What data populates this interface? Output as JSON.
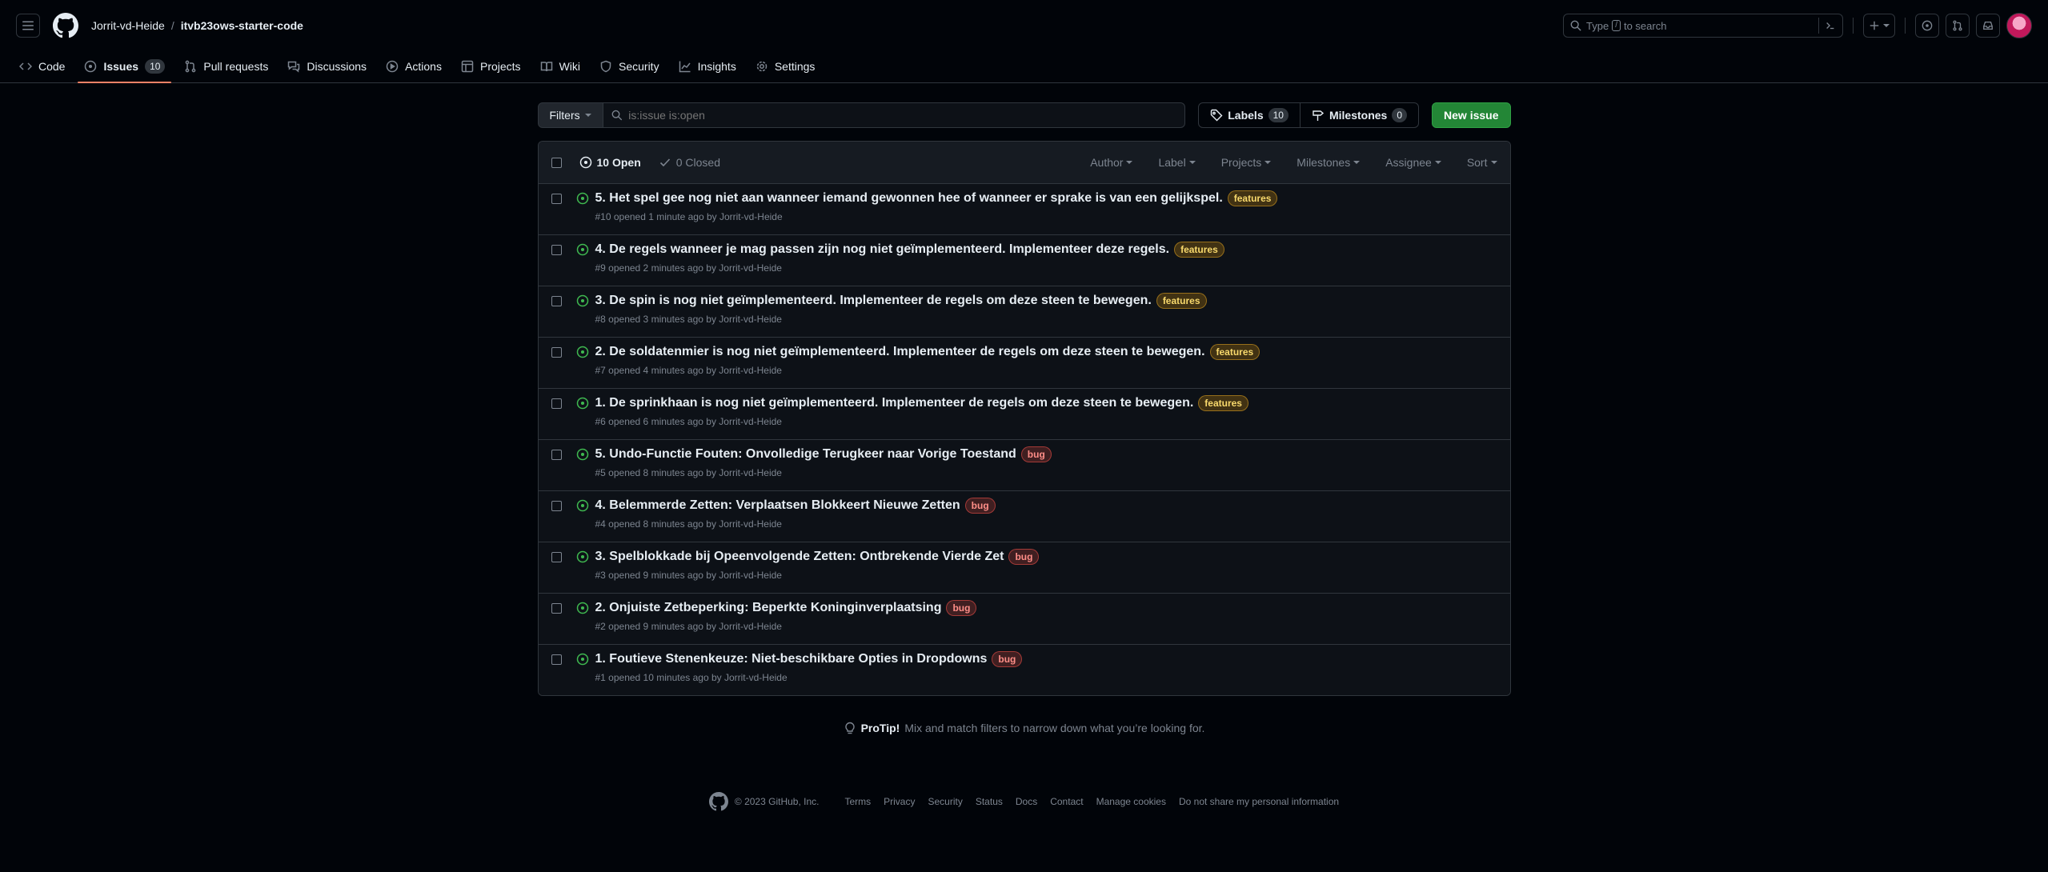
{
  "header": {
    "owner": "Jorrit-vd-Heide",
    "separator": "/",
    "repo": "itvb23ows-starter-code",
    "search_prefix": "Type",
    "search_key": "/",
    "search_suffix": "to search"
  },
  "nav": {
    "items": [
      {
        "label": "Code",
        "icon": "code-icon"
      },
      {
        "label": "Issues",
        "icon": "issue-opened-icon",
        "count": "10"
      },
      {
        "label": "Pull requests",
        "icon": "pull-request-icon"
      },
      {
        "label": "Discussions",
        "icon": "comment-discussion-icon"
      },
      {
        "label": "Actions",
        "icon": "play-icon"
      },
      {
        "label": "Projects",
        "icon": "table-icon"
      },
      {
        "label": "Wiki",
        "icon": "book-icon"
      },
      {
        "label": "Security",
        "icon": "shield-icon"
      },
      {
        "label": "Insights",
        "icon": "graph-icon"
      },
      {
        "label": "Settings",
        "icon": "gear-icon"
      }
    ]
  },
  "toolbar": {
    "filters_label": "Filters",
    "search_placeholder": "is:issue is:open",
    "labels_label": "Labels",
    "labels_count": "10",
    "milestones_label": "Milestones",
    "milestones_count": "0",
    "new_issue_label": "New issue"
  },
  "list_header": {
    "open_label": "10 Open",
    "closed_label": "0 Closed",
    "filters": [
      "Author",
      "Label",
      "Projects",
      "Milestones",
      "Assignee",
      "Sort"
    ]
  },
  "issues": [
    {
      "title": "5. Het spel gee nog niet aan wanneer iemand gewonnen hee of wanneer er sprake is van een gelijkspel.",
      "label": "features",
      "meta": "#10 opened 1 minute ago by Jorrit-vd-Heide"
    },
    {
      "title": "4. De regels wanneer je mag passen zijn nog niet geïmplementeerd. Implementeer deze regels.",
      "label": "features",
      "meta": "#9 opened 2 minutes ago by Jorrit-vd-Heide"
    },
    {
      "title": "3. De spin is nog niet geïmplementeerd. Implementeer de regels om deze steen te bewegen.",
      "label": "features",
      "meta": "#8 opened 3 minutes ago by Jorrit-vd-Heide"
    },
    {
      "title": "2. De soldatenmier is nog niet geïmplementeerd. Implementeer de regels om deze steen te bewegen.",
      "label": "features",
      "meta": "#7 opened 4 minutes ago by Jorrit-vd-Heide"
    },
    {
      "title": "1. De sprinkhaan is nog niet geïmplementeerd. Implementeer de regels om deze steen te bewegen.",
      "label": "features",
      "meta": "#6 opened 6 minutes ago by Jorrit-vd-Heide"
    },
    {
      "title": "5. Undo-Functie Fouten: Onvolledige Terugkeer naar Vorige Toestand",
      "label": "bug",
      "meta": "#5 opened 8 minutes ago by Jorrit-vd-Heide"
    },
    {
      "title": "4. Belemmerde Zetten: Verplaatsen Blokkeert Nieuwe Zetten",
      "label": "bug",
      "meta": "#4 opened 8 minutes ago by Jorrit-vd-Heide"
    },
    {
      "title": "3. Spelblokkade bij Opeenvolgende Zetten: Ontbrekende Vierde Zet",
      "label": "bug",
      "meta": "#3 opened 9 minutes ago by Jorrit-vd-Heide"
    },
    {
      "title": "2. Onjuiste Zetbeperking: Beperkte Koninginverplaatsing",
      "label": "bug",
      "meta": "#2 opened 9 minutes ago by Jorrit-vd-Heide"
    },
    {
      "title": "1. Foutieve Stenenkeuze: Niet-beschikbare Opties in Dropdowns",
      "label": "bug",
      "meta": "#1 opened 10 minutes ago by Jorrit-vd-Heide"
    }
  ],
  "protip": {
    "strong": "ProTip!",
    "text": "Mix and match filters to narrow down what you’re looking for."
  },
  "footer": {
    "copyright": "© 2023 GitHub, Inc.",
    "links": [
      "Terms",
      "Privacy",
      "Security",
      "Status",
      "Docs",
      "Contact",
      "Manage cookies",
      "Do not share my personal information"
    ]
  },
  "colors": {
    "background": "#010409",
    "accent_underline": "#f78166",
    "open_green": "#3fb950",
    "primary_button": "#238636"
  }
}
